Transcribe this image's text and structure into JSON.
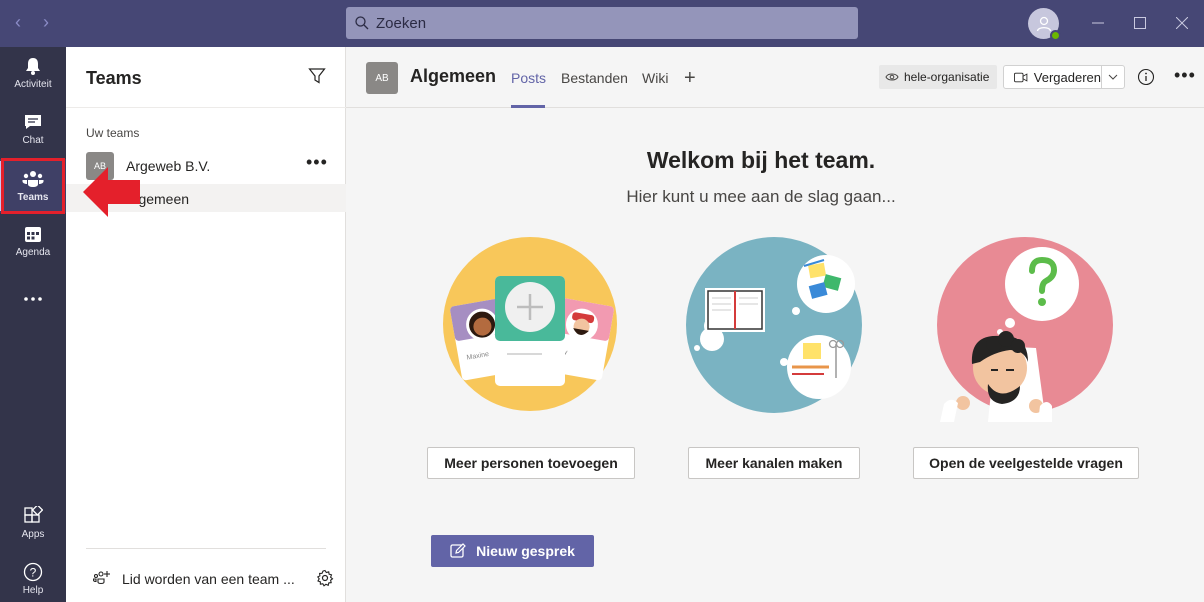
{
  "titlebar": {
    "search_placeholder": "Zoeken"
  },
  "rail": {
    "items": [
      {
        "label": "Activiteit",
        "icon": "bell-icon"
      },
      {
        "label": "Chat",
        "icon": "chat-icon"
      },
      {
        "label": "Teams",
        "icon": "teams-icon"
      },
      {
        "label": "Agenda",
        "icon": "calendar-icon"
      },
      {
        "label": "",
        "icon": "more-icon"
      },
      {
        "label": "Apps",
        "icon": "apps-icon"
      },
      {
        "label": "Help",
        "icon": "help-icon"
      }
    ],
    "active": "Teams"
  },
  "panel": {
    "title": "Teams",
    "section_label": "Uw teams",
    "team": {
      "initials": "AB",
      "name": "Argeweb B.V.",
      "more": "•••"
    },
    "channel": {
      "name": "Algemeen"
    },
    "join_label": "Lid worden van een team ..."
  },
  "main": {
    "channel_initials": "AB",
    "channel_title": "Algemeen",
    "tabs": [
      {
        "label": "Posts",
        "active": true
      },
      {
        "label": "Bestanden",
        "active": false
      },
      {
        "label": "Wiki",
        "active": false
      }
    ],
    "org_label": "hele-organisatie",
    "meet_label": "Vergaderen",
    "more": "•••"
  },
  "welcome": {
    "title": "Welkom bij het team.",
    "subtitle": "Hier kunt u mee aan de slag gaan...",
    "actions": [
      {
        "label": "Meer personen toevoegen"
      },
      {
        "label": "Meer kanalen maken"
      },
      {
        "label": "Open de veelgestelde vragen"
      }
    ],
    "card_names": [
      "Maxine",
      "y"
    ],
    "new_conversation": "Nieuw gesprek"
  },
  "colors": {
    "titlebar": "#464775",
    "rail": "#33344a",
    "accent": "#6264a7",
    "highlight": "#e4202b"
  }
}
